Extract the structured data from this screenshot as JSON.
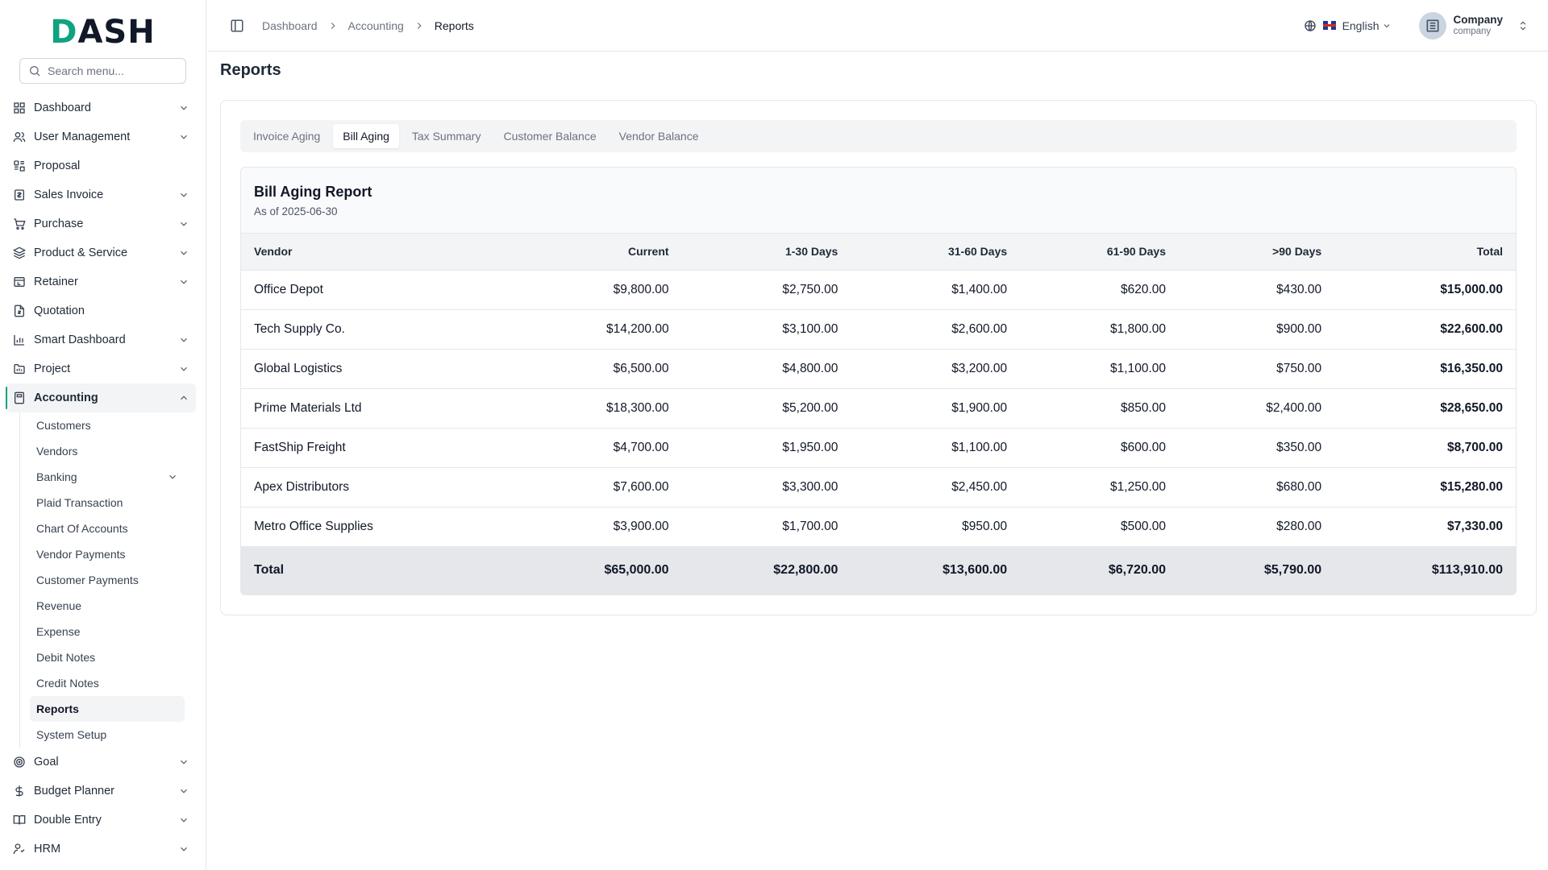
{
  "sidebar": {
    "logo": {
      "first": "D",
      "rest": "ASH"
    },
    "search_placeholder": "Search menu...",
    "items": [
      {
        "label": "Dashboard",
        "icon": "grid-icon",
        "chevron": true
      },
      {
        "label": "User Management",
        "icon": "users-icon",
        "chevron": true
      },
      {
        "label": "Proposal",
        "icon": "proposal-icon",
        "chevron": false
      },
      {
        "label": "Sales Invoice",
        "icon": "invoice-icon",
        "chevron": true
      },
      {
        "label": "Purchase",
        "icon": "cart-icon",
        "chevron": true
      },
      {
        "label": "Product & Service",
        "icon": "layers-icon",
        "chevron": true
      },
      {
        "label": "Retainer",
        "icon": "retainer-icon",
        "chevron": true
      },
      {
        "label": "Quotation",
        "icon": "quotation-icon",
        "chevron": false
      },
      {
        "label": "Smart Dashboard",
        "icon": "bar-chart-icon",
        "chevron": true
      },
      {
        "label": "Project",
        "icon": "folder-icon",
        "chevron": true
      },
      {
        "label": "Accounting",
        "icon": "calculator-icon",
        "chevron": true
      }
    ],
    "accounting_sub": [
      {
        "label": "Customers"
      },
      {
        "label": "Vendors"
      },
      {
        "label": "Banking",
        "chevron": true
      },
      {
        "label": "Plaid Transaction"
      },
      {
        "label": "Chart Of Accounts"
      },
      {
        "label": "Vendor Payments"
      },
      {
        "label": "Customer Payments"
      },
      {
        "label": "Revenue"
      },
      {
        "label": "Expense"
      },
      {
        "label": "Debit Notes"
      },
      {
        "label": "Credit Notes"
      },
      {
        "label": "Reports"
      },
      {
        "label": "System Setup"
      }
    ],
    "items_after": [
      {
        "label": "Goal",
        "icon": "target-icon"
      },
      {
        "label": "Budget Planner",
        "icon": "dollar-icon"
      },
      {
        "label": "Double Entry",
        "icon": "book-icon"
      },
      {
        "label": "HRM",
        "icon": "hrm-icon"
      }
    ]
  },
  "header": {
    "breadcrumb": [
      "Dashboard",
      "Accounting",
      "Reports"
    ],
    "language": "English",
    "user": {
      "name": "Company",
      "role": "company"
    }
  },
  "page": {
    "title": "Reports",
    "tabs": [
      "Invoice Aging",
      "Bill Aging",
      "Tax Summary",
      "Customer Balance",
      "Vendor Balance"
    ],
    "active_tab": "Bill Aging"
  },
  "report": {
    "title": "Bill Aging Report",
    "subtitle": "As of 2025-06-30",
    "columns": [
      "Vendor",
      "Current",
      "1-30 Days",
      "31-60 Days",
      "61-90 Days",
      ">90 Days",
      "Total"
    ],
    "rows": [
      [
        "Office Depot",
        "$9,800.00",
        "$2,750.00",
        "$1,400.00",
        "$620.00",
        "$430.00",
        "$15,000.00"
      ],
      [
        "Tech Supply Co.",
        "$14,200.00",
        "$3,100.00",
        "$2,600.00",
        "$1,800.00",
        "$900.00",
        "$22,600.00"
      ],
      [
        "Global Logistics",
        "$6,500.00",
        "$4,800.00",
        "$3,200.00",
        "$1,100.00",
        "$750.00",
        "$16,350.00"
      ],
      [
        "Prime Materials Ltd",
        "$18,300.00",
        "$5,200.00",
        "$1,900.00",
        "$850.00",
        "$2,400.00",
        "$28,650.00"
      ],
      [
        "FastShip Freight",
        "$4,700.00",
        "$1,950.00",
        "$1,100.00",
        "$600.00",
        "$350.00",
        "$8,700.00"
      ],
      [
        "Apex Distributors",
        "$7,600.00",
        "$3,300.00",
        "$2,450.00",
        "$1,250.00",
        "$680.00",
        "$15,280.00"
      ],
      [
        "Metro Office Supplies",
        "$3,900.00",
        "$1,700.00",
        "$950.00",
        "$500.00",
        "$280.00",
        "$7,330.00"
      ]
    ],
    "total": [
      "Total",
      "$65,000.00",
      "$22,800.00",
      "$13,600.00",
      "$6,720.00",
      "$5,790.00",
      "$113,910.00"
    ]
  },
  "colors": {
    "accent": "#0fa37f",
    "active_bg": "#f3f4f6"
  }
}
